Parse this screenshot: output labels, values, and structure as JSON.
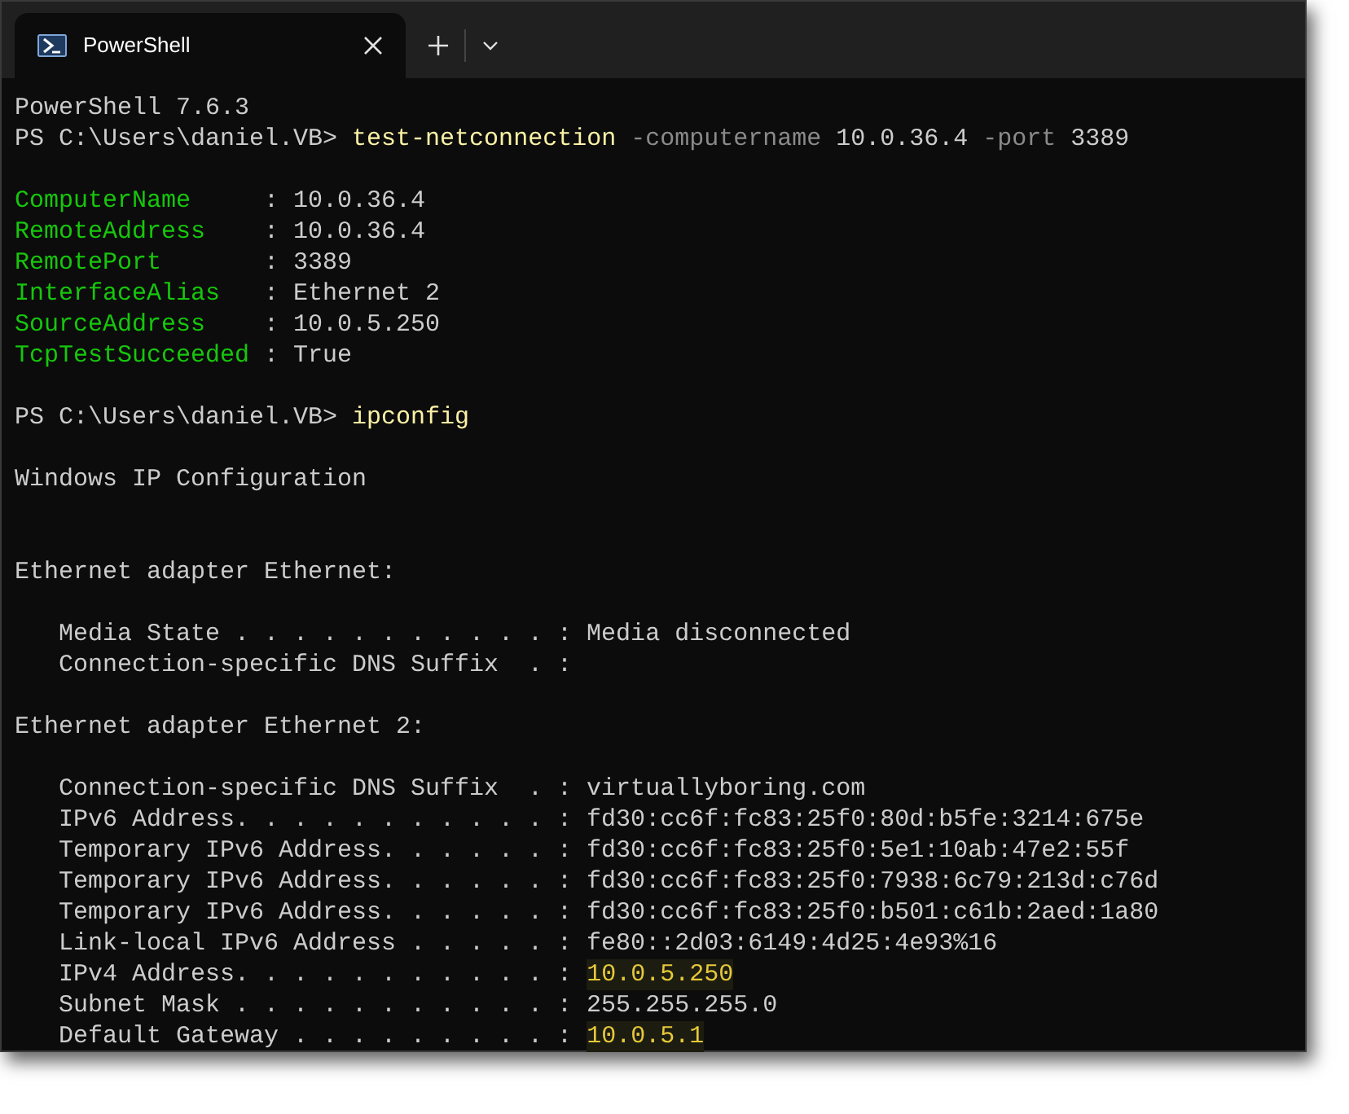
{
  "tab": {
    "title": "PowerShell",
    "selected": true
  },
  "lines": [
    {
      "kind": "text",
      "segments": [
        {
          "kind": "plain",
          "text": "PowerShell 7.6.3"
        }
      ]
    },
    {
      "kind": "text",
      "segments": [
        {
          "kind": "plain",
          "text": "PS C:\\Users\\daniel.VB> "
        },
        {
          "kind": "command",
          "text": "test-netconnection"
        },
        {
          "kind": "param",
          "text": " -computername"
        },
        {
          "kind": "plain",
          "text": " 10.0.36.4 "
        },
        {
          "kind": "param",
          "text": "-port"
        },
        {
          "kind": "plain",
          "text": " 3389"
        }
      ]
    },
    {
      "kind": "blank"
    },
    {
      "kind": "text",
      "segments": [
        {
          "kind": "key",
          "text": "ComputerName     "
        },
        {
          "kind": "plain",
          "text": ": 10.0.36.4"
        }
      ]
    },
    {
      "kind": "text",
      "segments": [
        {
          "kind": "key",
          "text": "RemoteAddress    "
        },
        {
          "kind": "plain",
          "text": ": 10.0.36.4"
        }
      ]
    },
    {
      "kind": "text",
      "segments": [
        {
          "kind": "key",
          "text": "RemotePort       "
        },
        {
          "kind": "plain",
          "text": ": 3389"
        }
      ]
    },
    {
      "kind": "text",
      "segments": [
        {
          "kind": "key",
          "text": "InterfaceAlias   "
        },
        {
          "kind": "plain",
          "text": ": Ethernet 2"
        }
      ]
    },
    {
      "kind": "text",
      "segments": [
        {
          "kind": "key",
          "text": "SourceAddress    "
        },
        {
          "kind": "plain",
          "text": ": 10.0.5.250"
        }
      ]
    },
    {
      "kind": "text",
      "segments": [
        {
          "kind": "key",
          "text": "TcpTestSucceeded "
        },
        {
          "kind": "plain",
          "text": ": True"
        }
      ]
    },
    {
      "kind": "blank"
    },
    {
      "kind": "text",
      "segments": [
        {
          "kind": "plain",
          "text": "PS C:\\Users\\daniel.VB> "
        },
        {
          "kind": "command",
          "text": "ipconfig"
        }
      ]
    },
    {
      "kind": "blank"
    },
    {
      "kind": "text",
      "segments": [
        {
          "kind": "plain",
          "text": "Windows IP Configuration"
        }
      ]
    },
    {
      "kind": "blank"
    },
    {
      "kind": "blank"
    },
    {
      "kind": "text",
      "segments": [
        {
          "kind": "plain",
          "text": "Ethernet adapter Ethernet:"
        }
      ]
    },
    {
      "kind": "blank"
    },
    {
      "kind": "text",
      "segments": [
        {
          "kind": "plain",
          "text": "   Media State . . . . . . . . . . . : Media disconnected"
        }
      ]
    },
    {
      "kind": "text",
      "segments": [
        {
          "kind": "plain",
          "text": "   Connection-specific DNS Suffix  . :"
        }
      ]
    },
    {
      "kind": "blank"
    },
    {
      "kind": "text",
      "segments": [
        {
          "kind": "plain",
          "text": "Ethernet adapter Ethernet 2:"
        }
      ]
    },
    {
      "kind": "blank"
    },
    {
      "kind": "text",
      "segments": [
        {
          "kind": "plain",
          "text": "   Connection-specific DNS Suffix  . : virtuallyboring.com"
        }
      ]
    },
    {
      "kind": "text",
      "segments": [
        {
          "kind": "plain",
          "text": "   IPv6 Address. . . . . . . . . . . : fd30:cc6f:fc83:25f0:80d:b5fe:3214:675e"
        }
      ]
    },
    {
      "kind": "text",
      "segments": [
        {
          "kind": "plain",
          "text": "   Temporary IPv6 Address. . . . . . : fd30:cc6f:fc83:25f0:5e1:10ab:47e2:55f"
        }
      ]
    },
    {
      "kind": "text",
      "segments": [
        {
          "kind": "plain",
          "text": "   Temporary IPv6 Address. . . . . . : fd30:cc6f:fc83:25f0:7938:6c79:213d:c76d"
        }
      ]
    },
    {
      "kind": "text",
      "segments": [
        {
          "kind": "plain",
          "text": "   Temporary IPv6 Address. . . . . . : fd30:cc6f:fc83:25f0:b501:c61b:2aed:1a80"
        }
      ]
    },
    {
      "kind": "text",
      "segments": [
        {
          "kind": "plain",
          "text": "   Link-local IPv6 Address . . . . . : fe80::2d03:6149:4d25:4e93%16"
        }
      ]
    },
    {
      "kind": "text",
      "segments": [
        {
          "kind": "plain",
          "text": "   IPv4 Address. . . . . . . . . . . : "
        },
        {
          "kind": "match",
          "text": "10.0.5.250"
        }
      ]
    },
    {
      "kind": "text",
      "segments": [
        {
          "kind": "plain",
          "text": "   Subnet Mask . . . . . . . . . . . : 255.255.255.0"
        }
      ]
    },
    {
      "kind": "text",
      "segments": [
        {
          "kind": "plain",
          "text": "   Default Gateway . . . . . . . . . : "
        },
        {
          "kind": "match",
          "text": "10.0.5.1"
        }
      ]
    }
  ]
}
